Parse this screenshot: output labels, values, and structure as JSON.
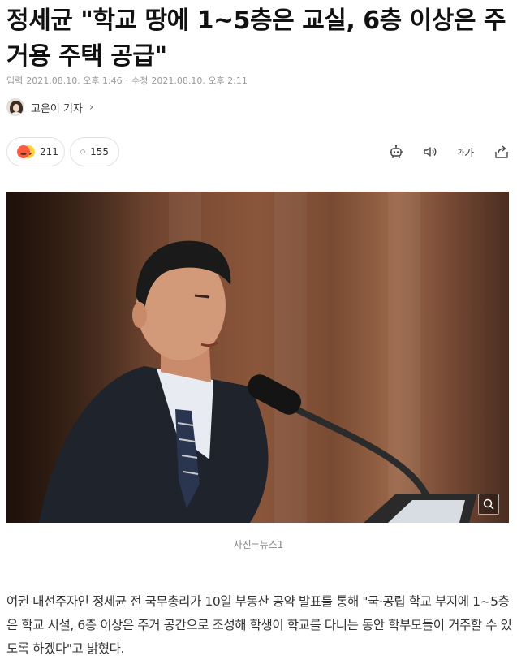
{
  "article": {
    "headline": "정세균 \"학교 땅에 1~5층은 교실, 6층 이상은 주거용 주택 공급\"",
    "meta": {
      "published_label": "입력",
      "published": "2021.08.10. 오후 1:46",
      "separator": "·",
      "modified_label": "수정",
      "modified": "2021.08.10. 오후 2:11"
    },
    "author": {
      "name": "고은이 기자",
      "chevron": "›"
    },
    "reactions": {
      "count": "211",
      "icons": [
        "angry-emoji-icon",
        "laugh-emoji-icon"
      ]
    },
    "comments": {
      "count": "155",
      "icon": "speech-bubble-icon"
    },
    "tools": {
      "summary_icon": "robot-icon",
      "tts_icon": "speaker-icon",
      "font_size_label_small": "가",
      "font_size_label_large": "가",
      "share_icon": "share-icon"
    },
    "photo": {
      "caption": "사진=뉴스1",
      "zoom_icon": "zoom-icon"
    },
    "body": "여권 대선주자인 정세균 전 국무총리가 10일 부동산 공약 발표를 통해 \"국·공립 학교 부지에 1~5층은 학교 시설, 6층 이상은 주거 공간으로 조성해 학생이 학교를 다니는 동안 학부모들이 거주할 수 있도록 하겠다\"고 밝혔다."
  }
}
